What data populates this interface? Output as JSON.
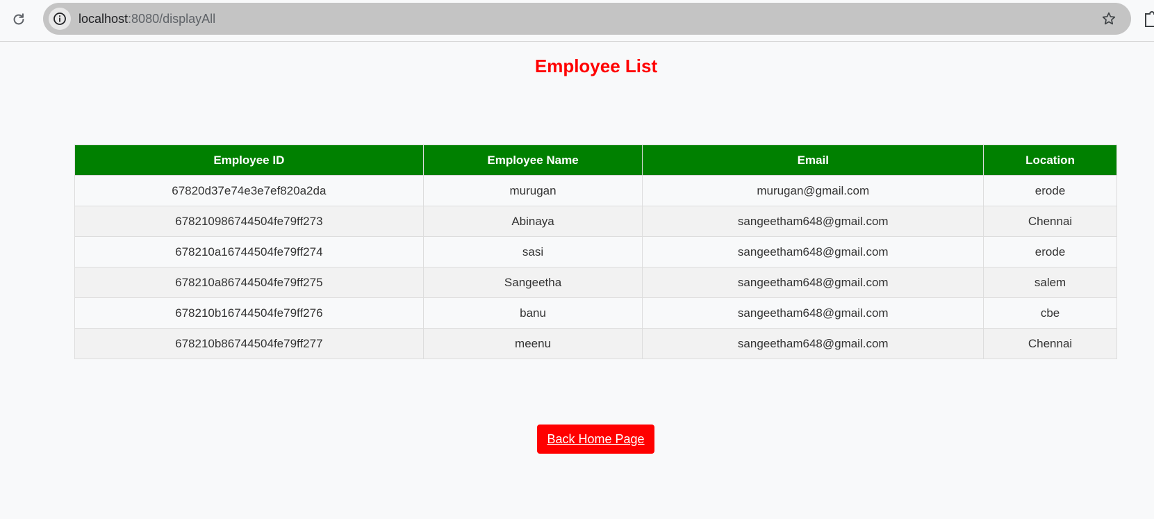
{
  "browser": {
    "url_host": "localhost",
    "url_path": ":8080/displayAll",
    "icons": {
      "reload": "reload-icon",
      "info": "info-icon",
      "bookmark": "star-icon",
      "extension": "extension-icon"
    }
  },
  "page": {
    "title": "Employee List",
    "back_button_label": "Back Home Page",
    "colors": {
      "title": "#ff0000",
      "header_bg": "#008000",
      "button_bg": "#ff0000"
    }
  },
  "table": {
    "columns": [
      "Employee ID",
      "Employee Name",
      "Email",
      "Location"
    ],
    "rows": [
      [
        "67820d37e74e3e7ef820a2da",
        "murugan",
        "murugan@gmail.com",
        "erode"
      ],
      [
        "678210986744504fe79ff273",
        "Abinaya",
        "sangeetham648@gmail.com",
        "Chennai"
      ],
      [
        "678210a16744504fe79ff274",
        "sasi",
        "sangeetham648@gmail.com",
        "erode"
      ],
      [
        "678210a86744504fe79ff275",
        "Sangeetha",
        "sangeetham648@gmail.com",
        "salem"
      ],
      [
        "678210b16744504fe79ff276",
        "banu",
        "sangeetham648@gmail.com",
        "cbe"
      ],
      [
        "678210b86744504fe79ff277",
        "meenu",
        "sangeetham648@gmail.com",
        "Chennai"
      ]
    ]
  }
}
